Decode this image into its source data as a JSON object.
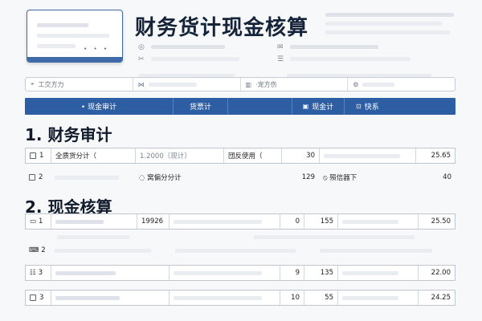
{
  "header": {
    "title": "财务货计现金核算",
    "thumbnail_dots": "• • •"
  },
  "toolbar": {
    "items": [
      {
        "icon": "⌖",
        "label": "工交方力"
      },
      {
        "icon": "⋈",
        "label": ""
      },
      {
        "icon": "▥",
        "label": "·宠方伤"
      },
      {
        "icon": "⚙",
        "label": ""
      }
    ]
  },
  "tabs": [
    {
      "label": "• 现金审计",
      "icon": ""
    },
    {
      "label": "货票计",
      "icon": ""
    },
    {
      "label": "",
      "icon": ""
    },
    {
      "label": "现金计",
      "icon": "▣"
    },
    {
      "label": "快系",
      "icon": "⊡"
    }
  ],
  "section1": {
    "title": "1. 财务审计",
    "rows": [
      {
        "num": "1",
        "name": "全质货分计（",
        "code": "1.2000〔现计〕",
        "desc": "団反使用（",
        "qty": "30",
        "note": "",
        "amount": "25.65"
      },
      {
        "num": "2",
        "name": "",
        "code": "◌ 窝偏分分计",
        "desc": "",
        "qty": "129",
        "note": "⦸ 殒信器下",
        "amount": "40"
      }
    ]
  },
  "section2": {
    "title": "2. 现金核算",
    "rows": [
      {
        "num": "1",
        "name": "",
        "code": "19926",
        "desc": "",
        "qty": "0",
        "qty2": "155",
        "amount": "25.50"
      },
      {
        "num": "2",
        "name": "",
        "code": "",
        "desc": "",
        "qty": "",
        "qty2": "",
        "amount": ""
      },
      {
        "num": "3",
        "name": "",
        "code": "",
        "desc": "",
        "qty": "9",
        "qty2": "135",
        "amount": "22.00"
      },
      {
        "num": "3",
        "name": "",
        "code": "",
        "desc": "",
        "qty": "10",
        "qty2": "55",
        "amount": "24.25"
      }
    ]
  }
}
